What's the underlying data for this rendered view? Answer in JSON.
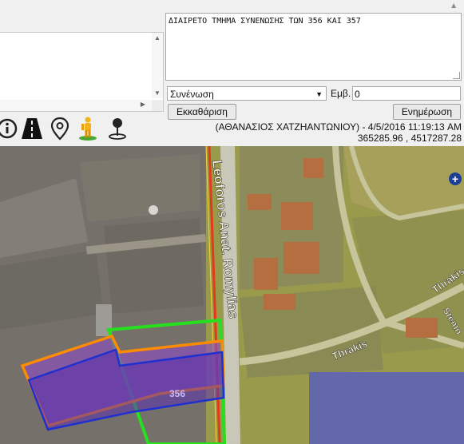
{
  "description": {
    "text": "ΔΙΑΙΡΕΤΟ ΤΜΗΜΑ ΣΥΝΕΝΩΣΗΣ ΤΩΝ 356 ΚΑΙ 357"
  },
  "controls": {
    "operation_selected": "Συνένωση",
    "area_label": "Εμβ.",
    "area_value": "0",
    "clear_button": "Εκκαθάριση",
    "update_button": "Ενημέρωση"
  },
  "toolbar": {
    "icons": [
      "info-icon",
      "road-icon",
      "map-pin-icon",
      "street-view-person-icon",
      "location-marker-icon"
    ]
  },
  "meta": {
    "author_date": "(ΑΘΑΝΑΣΙΟΣ ΧΑΤΖΗΑΝΤΩΝΙΟΥ) - 4/5/2016 11:19:13 AM",
    "coordinates": "365285.96 , 4517287.28"
  },
  "map": {
    "street_1": "Leoforos Anat. Romylias",
    "street_2": "Thrakis",
    "street_3": "Thrakis",
    "street_4": "Stemn",
    "parcel_label": "356"
  },
  "colors": {
    "parcel_fill": "#6a2fb0",
    "parcel_outline_orange": "#ff8c00",
    "parcel_outline_blue": "#1f2fd0",
    "parcel_outline_green": "#26e01f",
    "road_red": "#e33b1a",
    "plus_button": "#1c3f95"
  }
}
